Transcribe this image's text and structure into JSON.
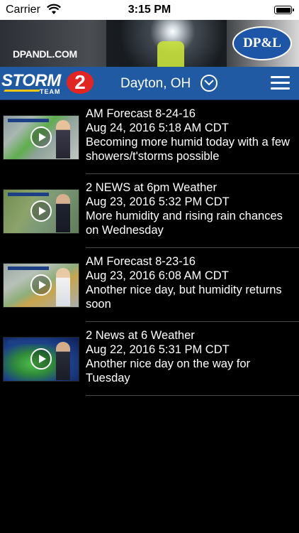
{
  "status_bar": {
    "carrier": "Carrier",
    "time": "3:15 PM"
  },
  "ad": {
    "url_text": "DPANDL.COM",
    "logo_text": "DP&L"
  },
  "header": {
    "brand_storm": "STORM",
    "brand_team": "TEAM",
    "brand_number": "2",
    "location": "Dayton, OH"
  },
  "videos": [
    {
      "title": "AM Forecast 8-24-16",
      "date": "Aug 24, 2016 5:18 AM CDT",
      "description": "Becoming more humid today with a few showers/t'storms possible"
    },
    {
      "title": "2 NEWS at 6pm Weather",
      "date": "Aug 23, 2016 5:32 PM CDT",
      "description": "More humidity and rising rain chances on Wednesday"
    },
    {
      "title": "AM Forecast 8-23-16",
      "date": "Aug 23, 2016 6:08 AM CDT",
      "description": "Another nice day, but humidity returns soon"
    },
    {
      "title": "2 News at 6 Weather",
      "date": "Aug 22, 2016 5:31 PM CDT",
      "description": "Another nice day on the way for Tuesday"
    }
  ],
  "colors": {
    "header_bg": "#205aa3",
    "badge_red": "#e32522",
    "divider": "#4b4b4b",
    "dpl_blue": "#1d56a6"
  },
  "icons": {
    "wifi": "wifi-icon",
    "battery": "battery-icon",
    "chevron": "chevron-down-circle-icon",
    "menu": "hamburger-menu-icon",
    "play": "play-icon"
  }
}
